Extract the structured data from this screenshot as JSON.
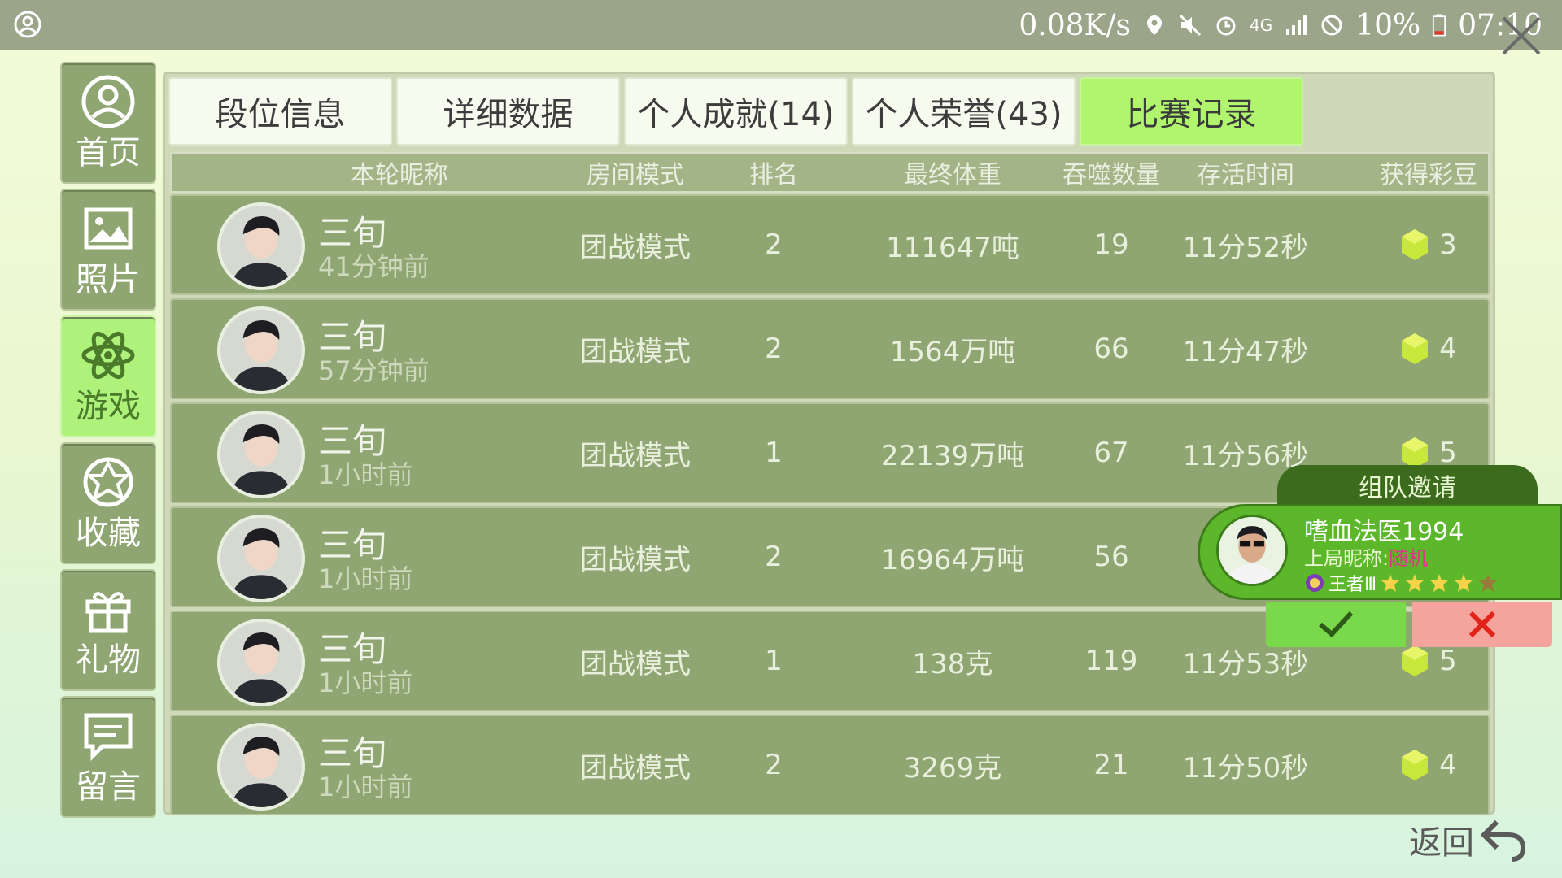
{
  "status_bar": {
    "net_speed": "0.08K/s",
    "network": "4G",
    "battery": "10%",
    "time": "07:10"
  },
  "sidebar": {
    "items": [
      {
        "label": "首页",
        "icon": "user-circle-icon",
        "active": false
      },
      {
        "label": "照片",
        "icon": "image-icon",
        "active": false
      },
      {
        "label": "游戏",
        "icon": "atom-icon",
        "active": true
      },
      {
        "label": "收藏",
        "icon": "flower-icon",
        "active": false
      },
      {
        "label": "礼物",
        "icon": "gift-icon",
        "active": false
      },
      {
        "label": "留言",
        "icon": "message-icon",
        "active": false
      }
    ]
  },
  "tabs": [
    {
      "label": "段位信息",
      "active": false
    },
    {
      "label": "详细数据",
      "active": false
    },
    {
      "label": "个人成就(14)",
      "active": false
    },
    {
      "label": "个人荣誉(43)",
      "active": false
    },
    {
      "label": "比赛记录",
      "active": true
    }
  ],
  "table": {
    "headers": {
      "nickname": "本轮昵称",
      "mode": "房间模式",
      "rank": "排名",
      "weight": "最终体重",
      "eaten": "吞噬数量",
      "survival": "存活时间",
      "beans": "获得彩豆"
    },
    "rows": [
      {
        "nickname": "三旬",
        "ago": "41分钟前",
        "mode": "团战模式",
        "rank": "2",
        "weight": "111647吨",
        "eaten": "19",
        "survival": "11分52秒",
        "beans": "3"
      },
      {
        "nickname": "三旬",
        "ago": "57分钟前",
        "mode": "团战模式",
        "rank": "2",
        "weight": "1564万吨",
        "eaten": "66",
        "survival": "11分47秒",
        "beans": "4"
      },
      {
        "nickname": "三旬",
        "ago": "1小时前",
        "mode": "团战模式",
        "rank": "1",
        "weight": "22139万吨",
        "eaten": "67",
        "survival": "11分56秒",
        "beans": "5"
      },
      {
        "nickname": "三旬",
        "ago": "1小时前",
        "mode": "团战模式",
        "rank": "2",
        "weight": "16964万吨",
        "eaten": "56",
        "survival": "",
        "beans": ""
      },
      {
        "nickname": "三旬",
        "ago": "1小时前",
        "mode": "团战模式",
        "rank": "1",
        "weight": "138克",
        "eaten": "119",
        "survival": "11分53秒",
        "beans": "5"
      },
      {
        "nickname": "三旬",
        "ago": "1小时前",
        "mode": "团战模式",
        "rank": "2",
        "weight": "3269克",
        "eaten": "21",
        "survival": "11分50秒",
        "beans": "4"
      }
    ]
  },
  "invite": {
    "title": "组队邀请",
    "name": "嗜血法医1994",
    "prev_label": "上局昵称:",
    "prev_nick": "随机",
    "rank_label": "王者Ⅲ",
    "stars": 4,
    "stars_total": 5,
    "accept_icon": "check-icon",
    "reject_icon": "close-icon"
  },
  "back_label": "返回",
  "colors": {
    "accent": "#b1f56f",
    "row_bg": "#8fa572",
    "invite_green": "#5cb82a",
    "reject": "#f4a39d"
  }
}
